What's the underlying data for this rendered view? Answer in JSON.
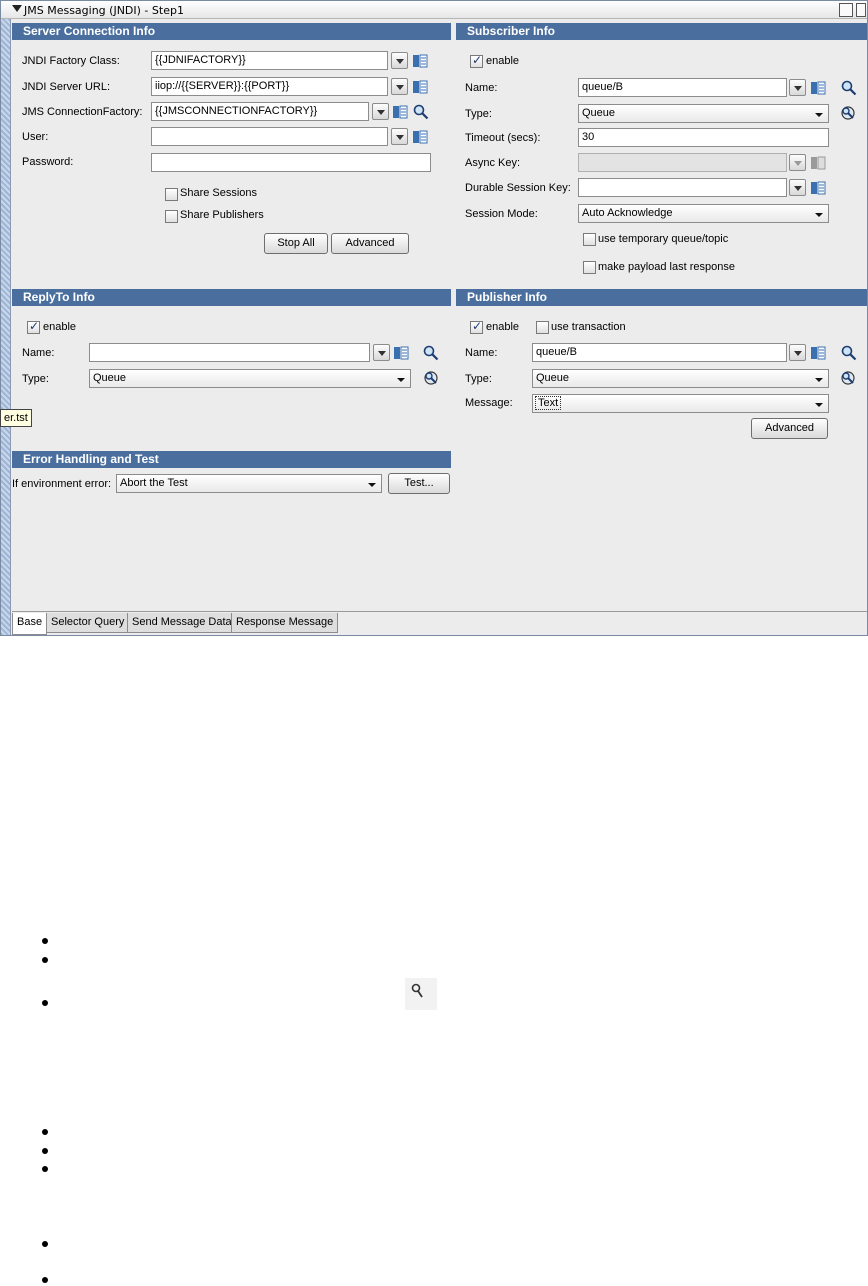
{
  "window": {
    "title": "JMS Messaging (JNDI) - Step1"
  },
  "server": {
    "header": "Server Connection Info",
    "jndi_factory_label": "JNDI Factory Class:",
    "jndi_factory_value": "{{JDNIFACTORY}}",
    "jndi_url_label": "JNDI Server URL:",
    "jndi_url_value": "iiop://{{SERVER}}:{{PORT}}",
    "jms_cf_label": "JMS ConnectionFactory:",
    "jms_cf_value": "{{JMSCONNECTIONFACTORY}}",
    "user_label": "User:",
    "user_value": "",
    "password_label": "Password:",
    "password_value": "",
    "share_sessions_label": "Share Sessions",
    "share_sessions_checked": false,
    "share_publishers_label": "Share Publishers",
    "share_publishers_checked": false,
    "stop_all_label": "Stop All",
    "advanced_label": "Advanced"
  },
  "subscriber": {
    "header": "Subscriber Info",
    "enable_label": "enable",
    "enable_checked": true,
    "name_label": "Name:",
    "name_value": "queue/B",
    "type_label": "Type:",
    "type_value": "Queue",
    "timeout_label": "Timeout (secs):",
    "timeout_value": "30",
    "async_label": "Async Key:",
    "async_value": "",
    "durable_label": "Durable Session Key:",
    "durable_value": "",
    "session_mode_label": "Session Mode:",
    "session_mode_value": "Auto Acknowledge",
    "temp_queue_label": "use temporary queue/topic",
    "temp_queue_checked": false,
    "payload_label": "make payload last response",
    "payload_checked": false
  },
  "replyto": {
    "header": "ReplyTo Info",
    "enable_label": "enable",
    "enable_checked": true,
    "name_label": "Name:",
    "name_value": "",
    "type_label": "Type:",
    "type_value": "Queue"
  },
  "publisher": {
    "header": "Publisher Info",
    "enable_label": "enable",
    "enable_checked": true,
    "transaction_label": "use transaction",
    "transaction_checked": false,
    "name_label": "Name:",
    "name_value": "queue/B",
    "type_label": "Type:",
    "type_value": "Queue",
    "message_label": "Message:",
    "message_value": "Text",
    "advanced_label": "Advanced"
  },
  "error": {
    "header": "Error Handling and Test",
    "env_error_label": "If environment error:",
    "env_error_value": "Abort the Test",
    "test_label": "Test..."
  },
  "tabs": [
    {
      "label": "Base",
      "active": true
    },
    {
      "label": "Selector Query",
      "active": false
    },
    {
      "label": "Send Message Data",
      "active": false
    },
    {
      "label": "Response Message",
      "active": false
    }
  ],
  "tooltip": "er.tst",
  "colors": {
    "section_header": "#4a6f9e",
    "window_bg": "#ececec",
    "tooltip_bg": "#ffffe1"
  }
}
